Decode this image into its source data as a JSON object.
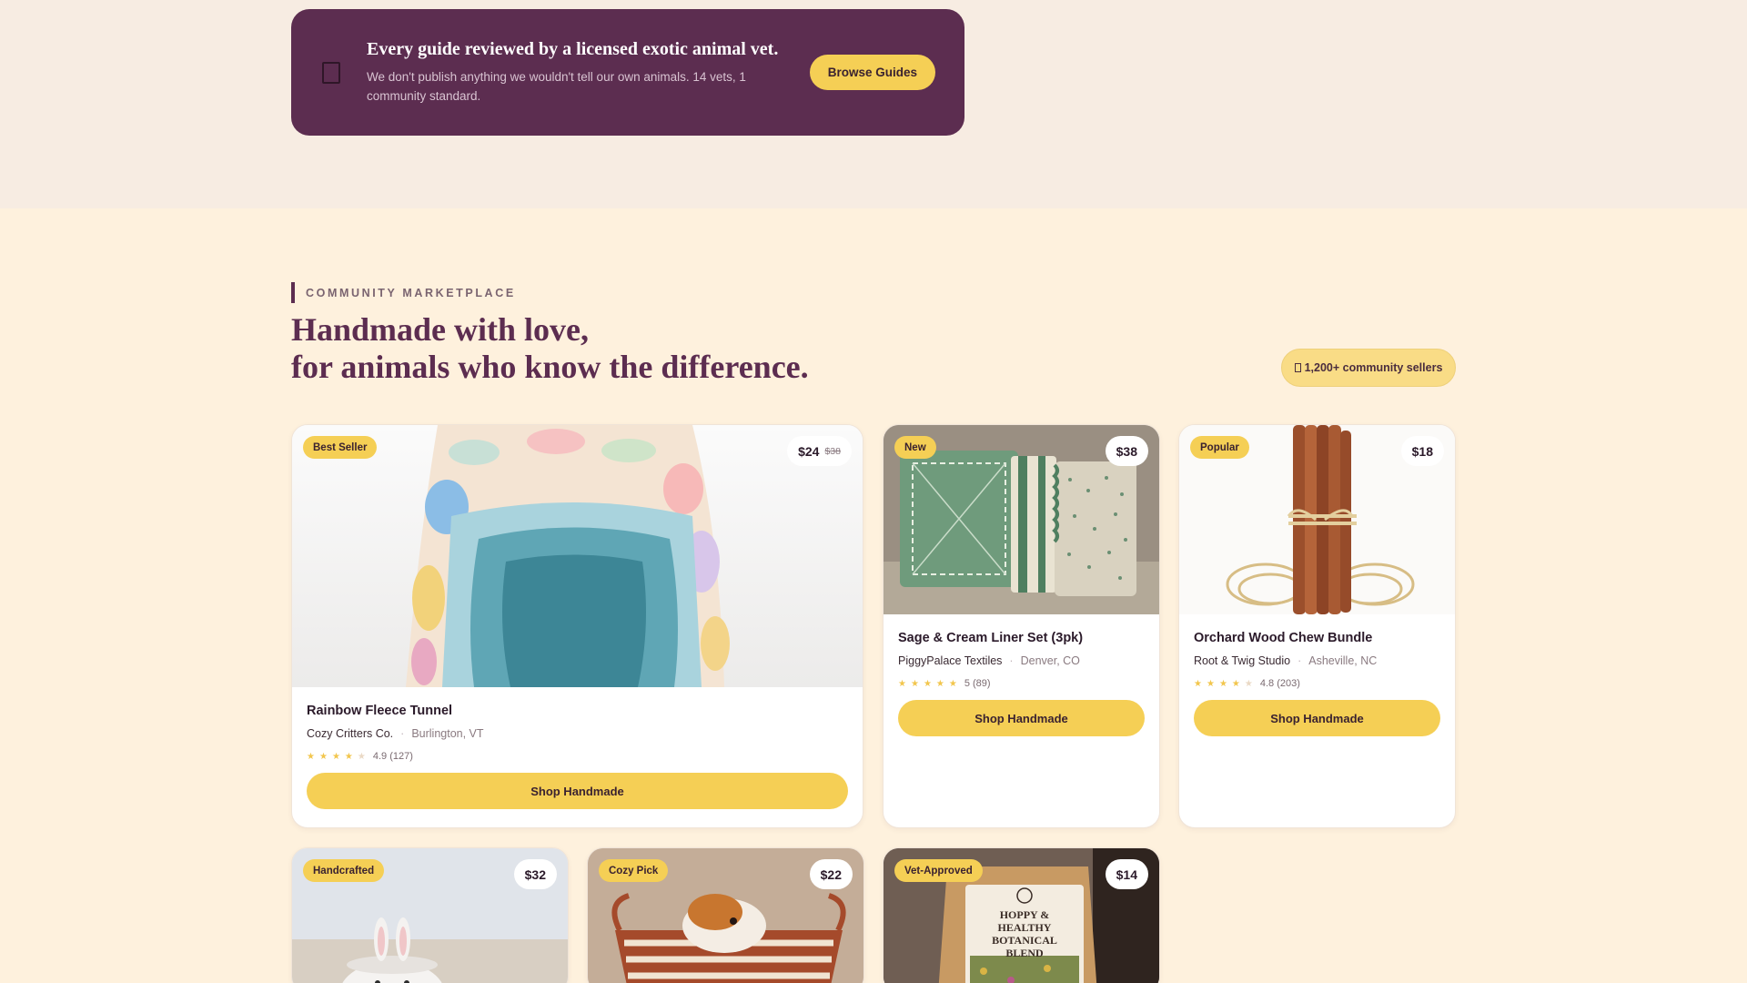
{
  "banner": {
    "title": "Every guide reviewed by a licensed exotic animal vet.",
    "subtitle": "We don't publish anything we wouldn't tell our own animals. 14 vets, 1 community standard.",
    "button": "Browse Guides"
  },
  "marketplace": {
    "eyebrow": "COMMUNITY MARKETPLACE",
    "headline_line1": "Handmade with love,",
    "headline_line2": "for animals who know the difference.",
    "sellers_pill": "1,200+ community sellers"
  },
  "products": [
    {
      "badge": "Best Seller",
      "price": "$24",
      "old_price": "$38",
      "title": "Rainbow Fleece Tunnel",
      "seller": "Cozy Critters Co.",
      "location": "Burlington, VT",
      "rating_text": "4.9 (127)",
      "rating": 4.9,
      "button": "Shop Handmade"
    },
    {
      "badge": "New",
      "price": "$38",
      "title": "Sage & Cream Liner Set (3pk)",
      "seller": "PiggyPalace Textiles",
      "location": "Denver, CO",
      "rating_text": "5 (89)",
      "rating": 5,
      "button": "Shop Handmade"
    },
    {
      "badge": "Popular",
      "price": "$18",
      "title": "Orchard Wood Chew Bundle",
      "seller": "Root & Twig Studio",
      "location": "Asheville, NC",
      "rating_text": "4.8 (203)",
      "rating": 4.8,
      "button": "Shop Handmade"
    },
    {
      "badge": "Handcrafted",
      "price": "$32"
    },
    {
      "badge": "Cozy Pick",
      "price": "$22"
    },
    {
      "badge": "Vet-Approved",
      "price": "$14",
      "package_text": "HOPPY & HEALTHY BOTANICAL BLEND"
    }
  ],
  "colors": {
    "plum": "#5c2d50",
    "yellow": "#f5cf55",
    "cream": "#fef1dd"
  }
}
